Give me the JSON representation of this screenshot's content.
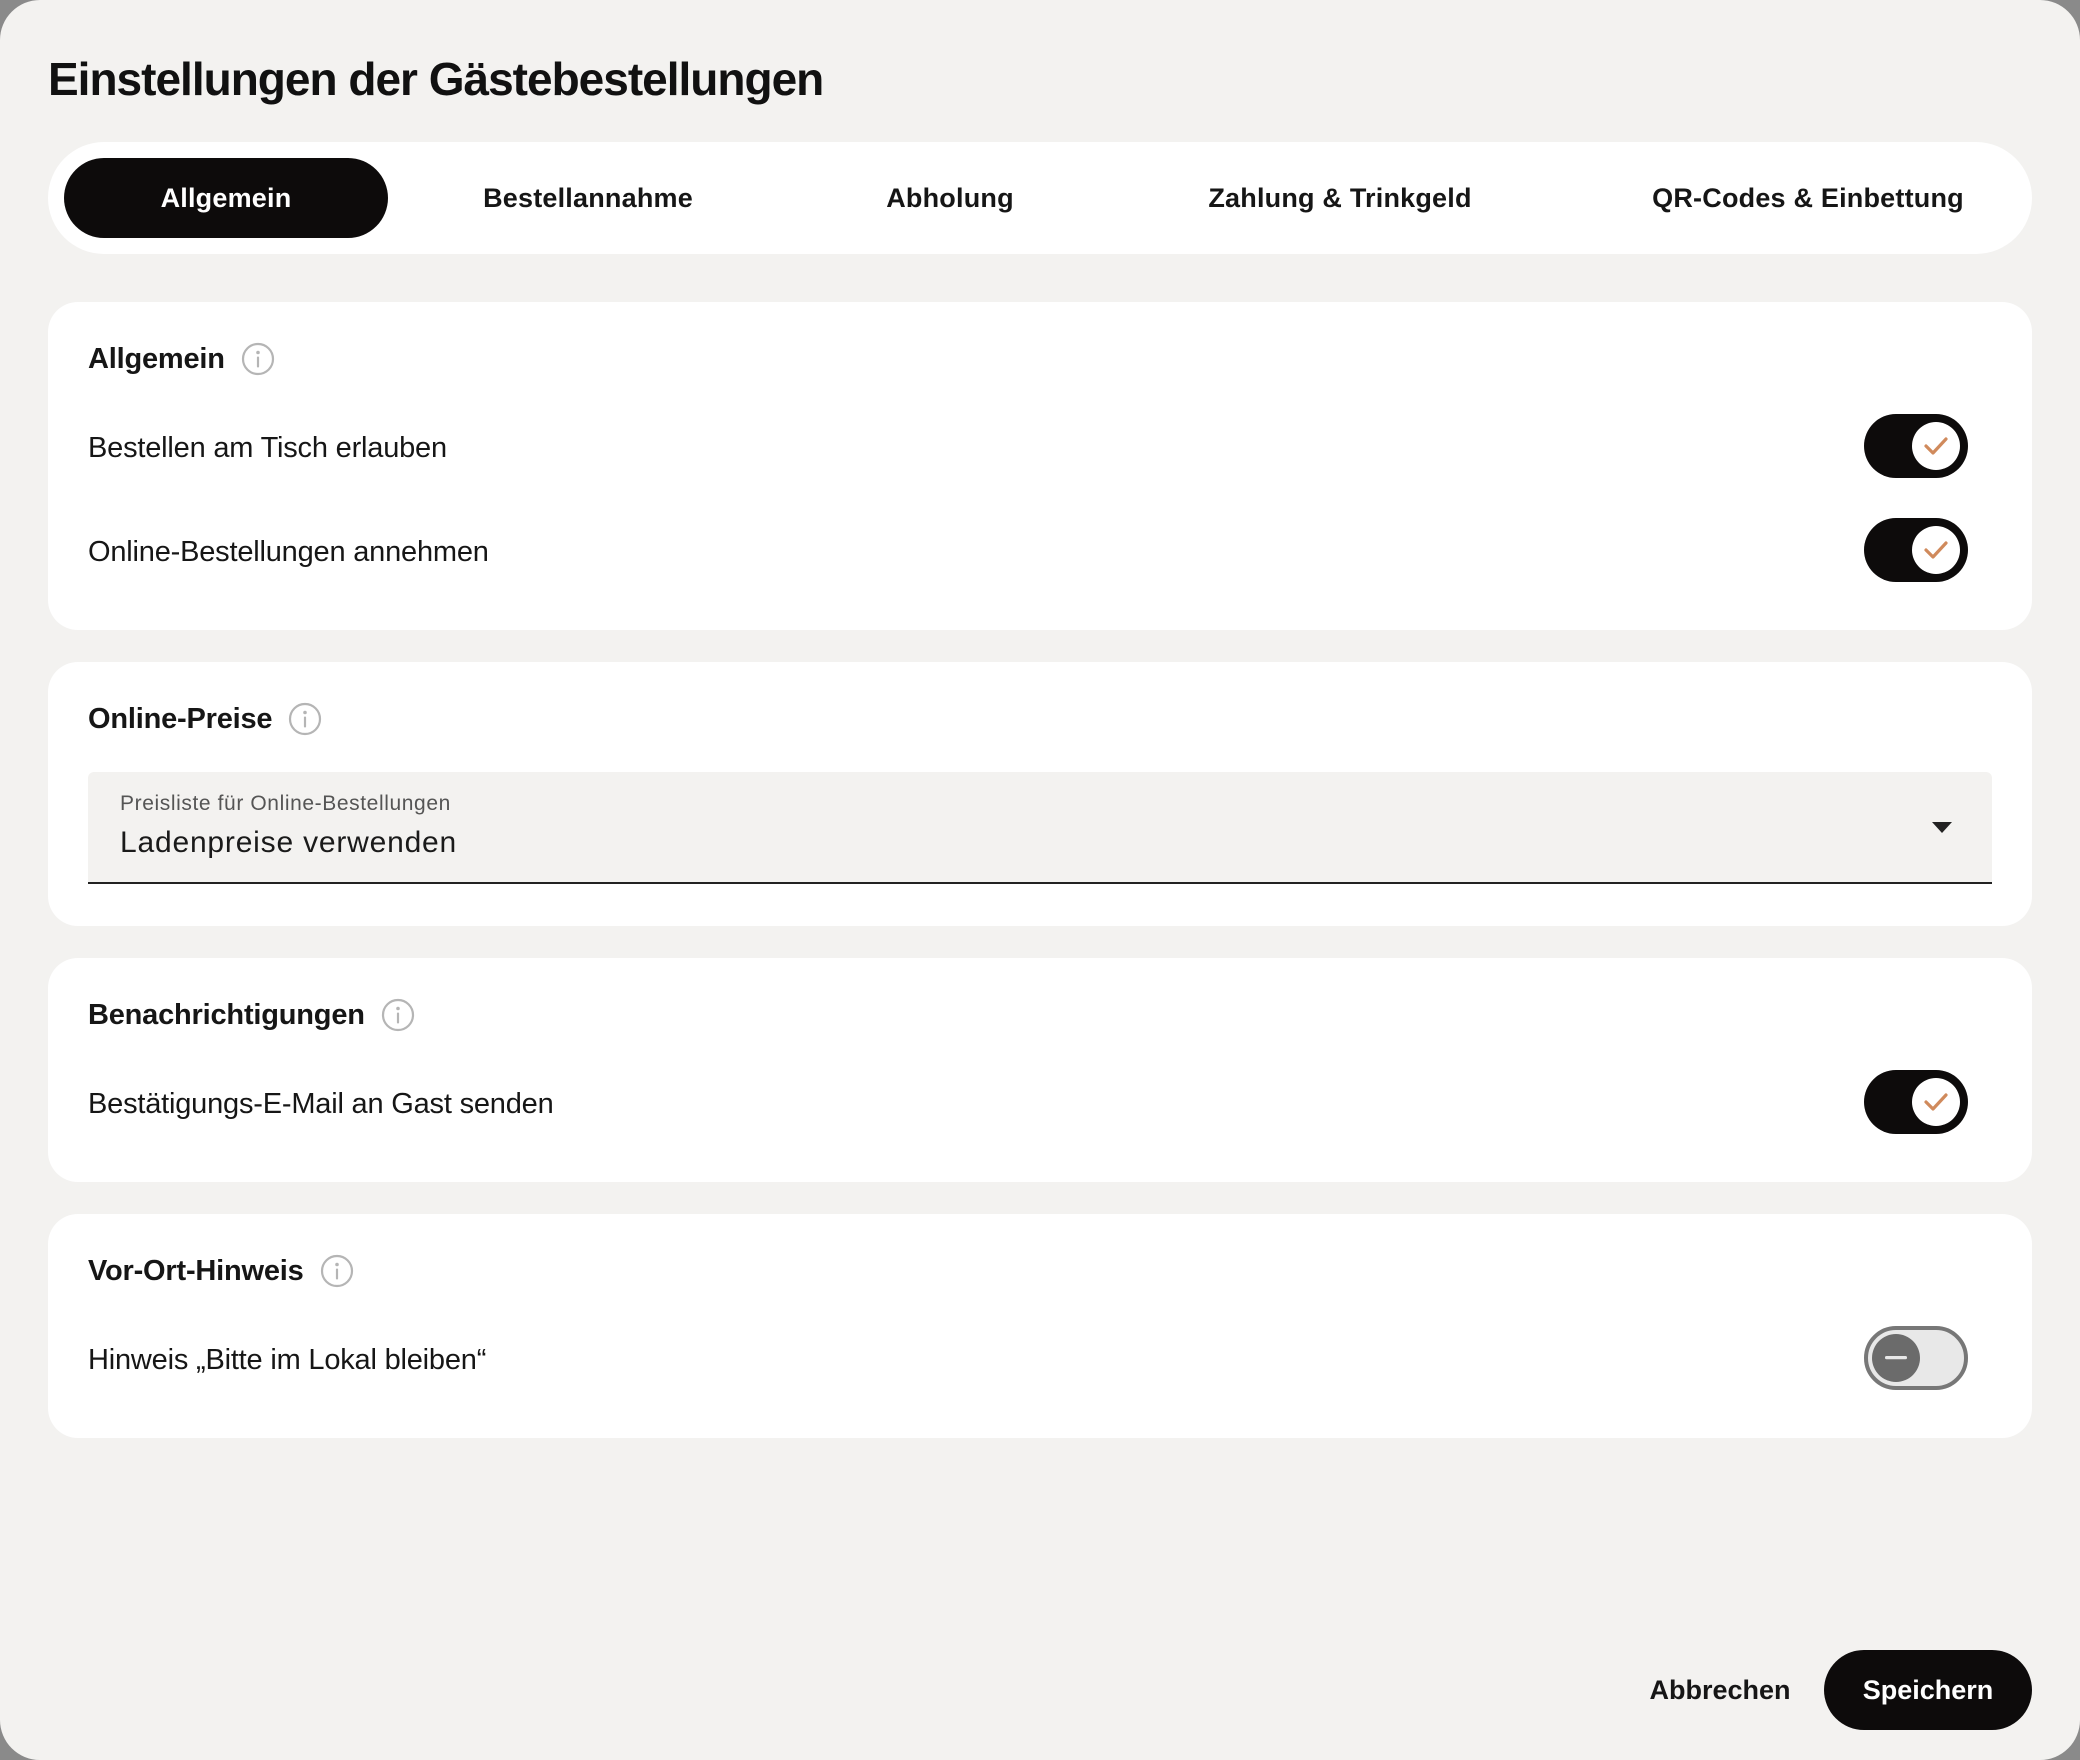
{
  "dialog": {
    "title": "Einstellungen der Gästebestellungen"
  },
  "tabs": [
    {
      "label": "Allgemein",
      "active": true
    },
    {
      "label": "Bestellannahme",
      "active": false
    },
    {
      "label": "Abholung",
      "active": false
    },
    {
      "label": "Zahlung & Trinkgeld",
      "active": false
    },
    {
      "label": "QR-Codes & Einbettung",
      "active": false
    }
  ],
  "sections": {
    "general": {
      "title": "Allgemein",
      "icon": "info-icon",
      "rows": [
        {
          "label": "Bestellen am Tisch erlauben",
          "enabled": true
        },
        {
          "label": "Online-Bestellungen annehmen",
          "enabled": true
        }
      ]
    },
    "pricing": {
      "title": "Online-Preise",
      "icon": "info-icon",
      "select": {
        "label": "Preisliste für Online-Bestellungen",
        "value": "Ladenpreise verwenden"
      }
    },
    "notifications": {
      "title": "Benachrichtigungen",
      "icon": "info-icon",
      "rows": [
        {
          "label": "Bestätigungs-E-Mail an Gast senden",
          "enabled": true
        }
      ]
    },
    "onsite": {
      "title": "Vor-Ort-Hinweis",
      "icon": "info-icon",
      "rows": [
        {
          "label": "Hinweis „Bitte im Lokal bleiben“",
          "enabled": false
        }
      ]
    }
  },
  "footer": {
    "cancel_label": "Abbrechen",
    "save_label": "Speichern"
  },
  "colors": {
    "background": "#f3f2f0",
    "card": "#ffffff",
    "primary": "#0d0b0b",
    "check_accent": "#d08a5c",
    "info_icon": "#b5b5b5"
  }
}
